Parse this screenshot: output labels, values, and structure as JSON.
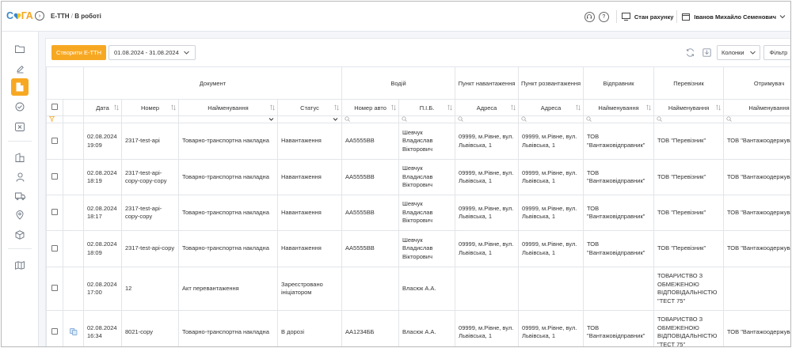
{
  "app": {
    "logo_left": "С",
    "logo_right": "ГА",
    "breadcrumb_section": "Е-ТТН",
    "breadcrumb_sep": "/",
    "breadcrumb_page": "В роботі",
    "account_status": "Стан рахунку",
    "user_name": "Іванов Михайло Семенович",
    "accent_color": "#f7a823",
    "logo_blue": "#3c88c7"
  },
  "toolbar": {
    "create_label": "Створити Е-ТТН",
    "date_range": "01.08.2024 - 31.08.2024",
    "columns_label": "Колонки",
    "filter_label": "Фільтр"
  },
  "table": {
    "groups": {
      "document": "Документ",
      "driver": "Водій",
      "load_point": "Пункт навантаження",
      "unload_point": "Пункт розвантаження",
      "sender": "Відправник",
      "carrier": "Перевізник",
      "receiver": "Отримувач"
    },
    "columns": {
      "date": "Дата",
      "number": "Номер",
      "name": "Найменування",
      "status": "Статус",
      "car_number": "Номер авто",
      "driver_name": "П.І.Б.",
      "load_address": "Адреса",
      "unload_address": "Адреса",
      "sender_name": "Найменування",
      "carrier_name": "Найменування",
      "receiver_name": "Найменування"
    },
    "rows": [
      {
        "date": "02.08.2024 19:09",
        "number": "2317-test-api",
        "name": "Товарно-транспортна накладна",
        "status": "Навантаження",
        "car": "АА5555ВВ",
        "driver": "Шевчук Владислав Вікторович",
        "load": "09999, м.Рівне, вул. Львівська, 1",
        "unload": "09999, м.Рівне, вул. Львівська, 1",
        "sender": "ТОВ \"Вантажовідправник\"",
        "carrier": "ТОВ \"Перевізник\"",
        "receiver": "ТОВ \"Вантажоодержувач\""
      },
      {
        "date": "02.08.2024 18:19",
        "number": "2317-test-api-copy-copy-copy",
        "name": "Товарно-транспортна накладна",
        "status": "Навантаження",
        "car": "АА5555ВВ",
        "driver": "Шевчук Владислав Вікторович",
        "load": "09999, м.Рівне, вул. Львівська, 1",
        "unload": "09999, м.Рівне, вул. Львівська, 1",
        "sender": "ТОВ \"Вантажовідправник\"",
        "carrier": "ТОВ \"Перевізник\"",
        "receiver": "ТОВ \"Вантажоодержувач\""
      },
      {
        "date": "02.08.2024 18:17",
        "number": "2317-test-api-copy-copy",
        "name": "Товарно-транспортна накладна",
        "status": "Навантаження",
        "car": "АА5555ВВ",
        "driver": "Шевчук Владислав Вікторович",
        "load": "09999, м.Рівне, вул. Львівська, 1",
        "unload": "09999, м.Рівне, вул. Львівська, 1",
        "sender": "ТОВ \"Вантажовідправник\"",
        "carrier": "ТОВ \"Перевізник\"",
        "receiver": "ТОВ \"Вантажоодержувач\""
      },
      {
        "date": "02.08.2024 18:09",
        "number": "2317-test-api-copy",
        "name": "Товарно-транспортна накладна",
        "status": "Навантаження",
        "car": "АА5555ВВ",
        "driver": "Шевчук Владислав Вікторович",
        "load": "09999, м.Рівне, вул. Львівська, 1",
        "unload": "09999, м.Рівне, вул. Львівська, 1",
        "sender": "ТОВ \"Вантажовідправник\"",
        "carrier": "ТОВ \"Перевізник\"",
        "receiver": "ТОВ \"Вантажоодержувач\""
      },
      {
        "date": "02.08.2024 17:00",
        "number": "12",
        "name": "Акт перевантаження",
        "status": "Зареєстровано ініціатором",
        "car": "",
        "driver": "Власюк А.А.",
        "load": "",
        "unload": "",
        "sender": "",
        "carrier": "ТОВАРИСТВО З ОБМЕЖЕНОЮ ВІДПОВІДАЛЬНІСТЮ \"ТЕСТ 75\"",
        "receiver": ""
      },
      {
        "date": "02.08.2024 16:34",
        "number": "8021-copy",
        "name": "Товарно-транспортна накладна",
        "status": "В дорозі",
        "car": "АА1234ББ",
        "driver": "Власюк А.А.",
        "load": "09999, м.Рівне, вул. Львівська, 1",
        "unload": "09999, м.Рівне, вул. Львівська, 1",
        "sender": "ТОВ \"Вантажовідправник\"",
        "carrier": "ТОВАРИСТВО З ОБМЕЖЕНОЮ ВІДПОВІДАЛЬНІСТЮ \"ТЕСТ 75\"",
        "receiver": "ТОВ \"Вантажоодержувач\""
      }
    ]
  }
}
